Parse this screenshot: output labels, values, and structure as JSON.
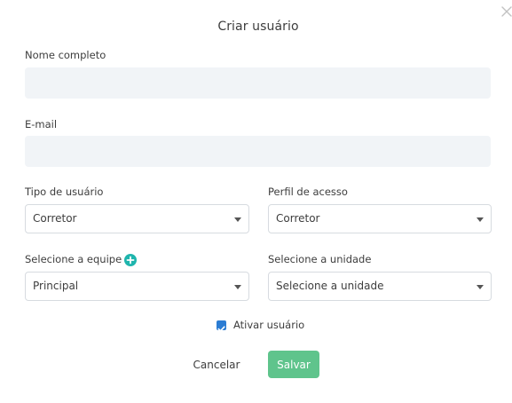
{
  "modal": {
    "title": "Criar usuário",
    "close_icon": "close-icon"
  },
  "form": {
    "full_name": {
      "label": "Nome completo",
      "value": "",
      "placeholder": ""
    },
    "email": {
      "label": "E-mail",
      "value": "",
      "placeholder": ""
    },
    "user_type": {
      "label": "Tipo de usuário",
      "selected": "Corretor"
    },
    "access_profile": {
      "label": "Perfil de acesso",
      "selected": "Corretor"
    },
    "team": {
      "label": "Selecione a equipe",
      "selected": "Principal",
      "add_icon": "plus-circle-icon"
    },
    "unit": {
      "label": "Selecione a unidade",
      "selected": "Selecione a unidade"
    },
    "activate_user": {
      "label": "Ativar usuário",
      "checked": true
    }
  },
  "actions": {
    "cancel_label": "Cancelar",
    "save_label": "Salvar"
  },
  "colors": {
    "save_button": "#5fc48c",
    "add_icon": "#1fb5ad",
    "checkbox": "#2b7cd3",
    "input_background": "#f1f4f7",
    "select_border": "#d7dbe0"
  }
}
